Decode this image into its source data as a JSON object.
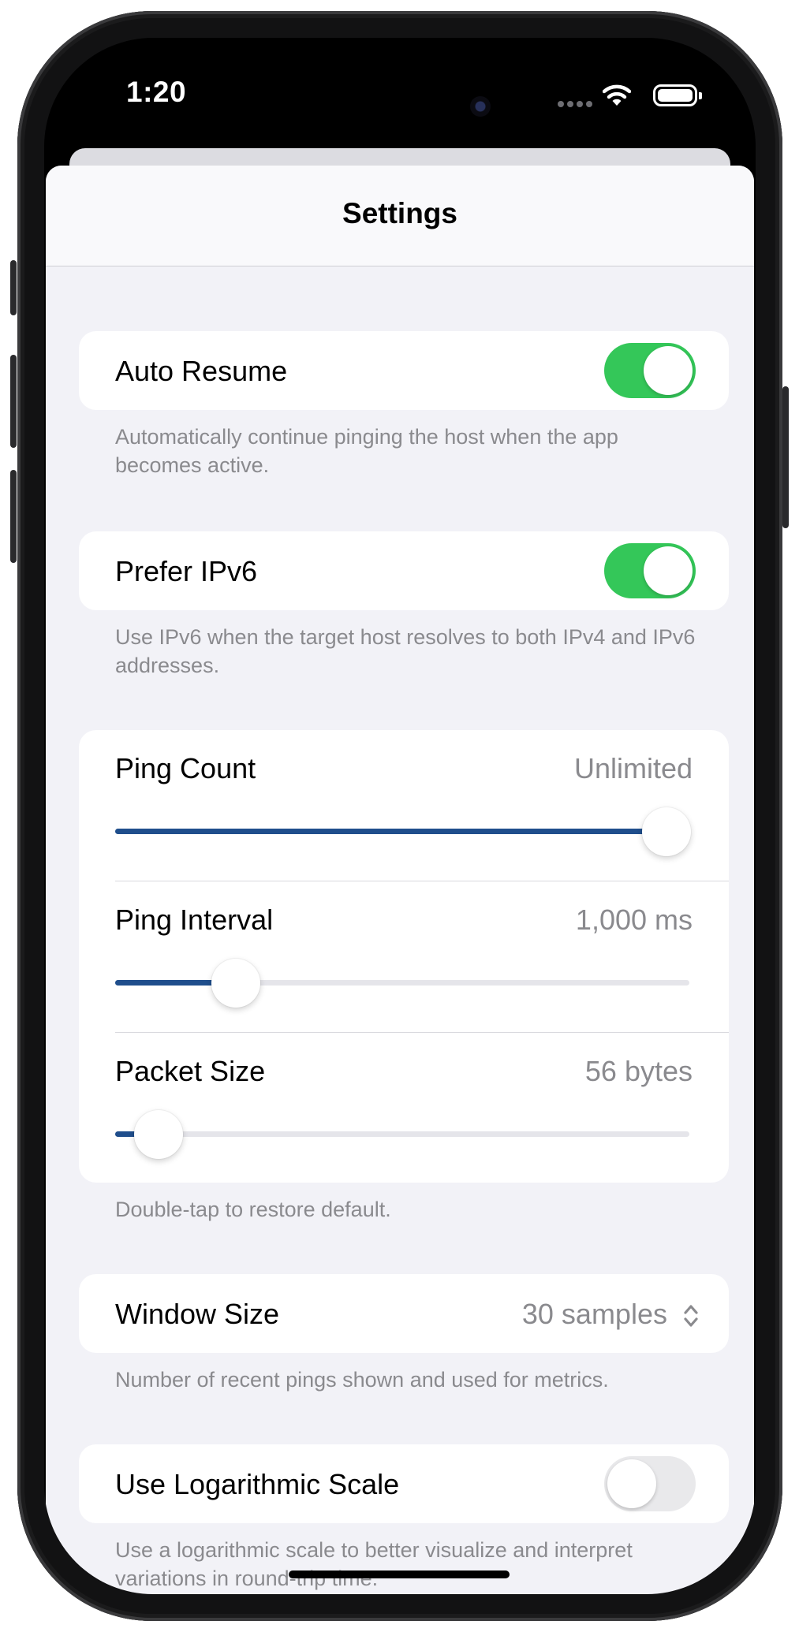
{
  "status_bar": {
    "time": "1:20"
  },
  "nav": {
    "title": "Settings"
  },
  "settings": {
    "auto_resume": {
      "label": "Auto Resume",
      "enabled": true,
      "footer": "Automatically continue pinging the host when the app becomes active."
    },
    "prefer_ipv6": {
      "label": "Prefer IPv6",
      "enabled": true,
      "footer": "Use IPv6 when the target host resolves to both IPv4 and IPv6 addresses."
    },
    "sliders": {
      "ping_count": {
        "label": "Ping Count",
        "value": "Unlimited",
        "fraction": 0.96
      },
      "ping_interval": {
        "label": "Ping Interval",
        "value": "1,000 ms",
        "fraction": 0.21
      },
      "packet_size": {
        "label": "Packet Size",
        "value": "56 bytes",
        "fraction": 0.075
      },
      "footer": "Double-tap to restore default."
    },
    "window_size": {
      "label": "Window Size",
      "value": "30 samples",
      "footer": "Number of recent pings shown and used for metrics."
    },
    "log_scale": {
      "label": "Use Logarithmic Scale",
      "enabled": false,
      "footer": "Use a logarithmic scale to better visualize and interpret variations in round-trip time."
    }
  },
  "colors": {
    "toggle_on": "#34c759",
    "slider_fill": "#1f4e8c",
    "secondary_text": "#8a8a8e",
    "grouped_background": "#f2f2f7"
  },
  "icons": {
    "signal": "cellular-signal-icon",
    "wifi": "wifi-icon",
    "battery": "battery-icon",
    "updown": "chevron-up-down-icon"
  }
}
